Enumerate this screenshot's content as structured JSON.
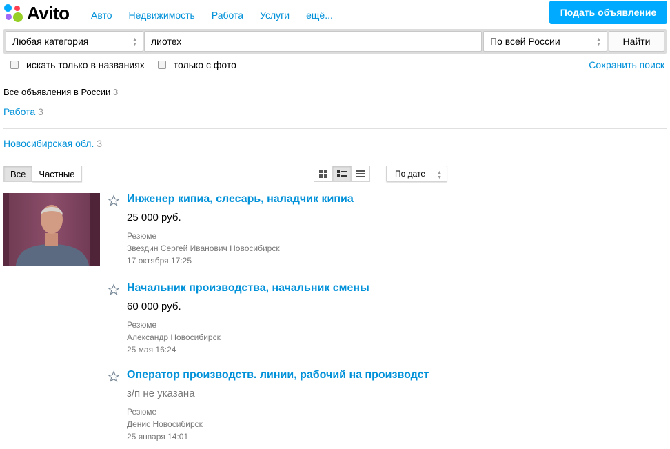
{
  "header": {
    "logo_text": "Avito",
    "nav": [
      "Авто",
      "Недвижимость",
      "Работа",
      "Услуги",
      "ещё..."
    ],
    "post_button": "Подать объявление"
  },
  "search": {
    "category": "Любая категория",
    "query": "лиотех",
    "region": "По всей России",
    "find_button": "Найти",
    "only_titles": "искать только в названиях",
    "only_photo": "только с фото",
    "save_search": "Сохранить поиск"
  },
  "filters": {
    "all_ads": "Все объявления в России",
    "all_ads_count": "3",
    "category": "Работа",
    "category_count": "3",
    "region": "Новосибирская обл.",
    "region_count": "3"
  },
  "controls": {
    "seller_all": "Все",
    "seller_private": "Частные",
    "sort": "По дате"
  },
  "colors": {
    "accent": "#00aaff",
    "link": "#0091d9"
  },
  "listings": [
    {
      "title": "Инженер кипиа, слесарь, наладчик кипиа",
      "price": "25 000 руб.",
      "type": "Резюме",
      "seller": "Звездин Сергей Иванович Новосибирск",
      "date": "17 октября 17:25"
    },
    {
      "title": "Начальник производства, начальник смены",
      "price": "60 000 руб.",
      "type": "Резюме",
      "seller": "Александр Новосибирск",
      "date": "25 мая 16:24"
    },
    {
      "title": "Оператор производств. линии, рабочий на производст",
      "price": "з/п не указана",
      "type": "Резюме",
      "seller": "Денис Новосибирск",
      "date": "25 января 14:01"
    }
  ]
}
